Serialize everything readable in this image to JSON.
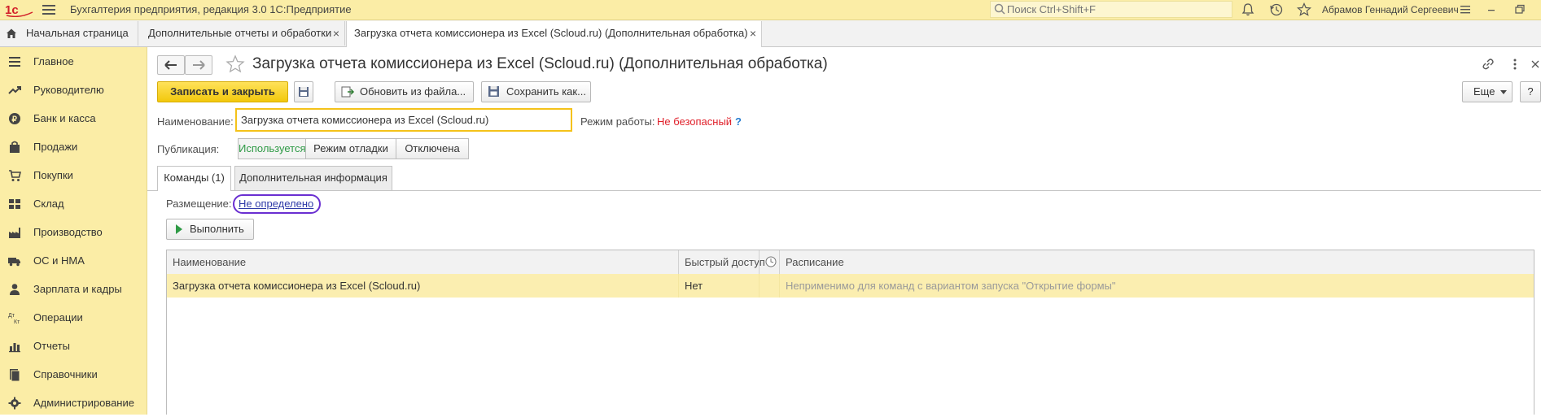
{
  "app": {
    "title": "Бухгалтерия предприятия, редакция 3.0 1С:Предприятие",
    "search_placeholder": "Поиск Ctrl+Shift+F",
    "user": "Абрамов Геннадий Сергеевич"
  },
  "tabs": {
    "home": "Начальная страница",
    "items": [
      {
        "label": "Дополнительные отчеты и обработки",
        "close": "×"
      },
      {
        "label": "Загрузка отчета комиссионера из Excel (Scloud.ru) (Дополнительная обработка)",
        "close": "×"
      }
    ]
  },
  "sidebar": {
    "items": [
      {
        "label": "Главное",
        "icon": "menu-lines-icon"
      },
      {
        "label": "Руководителю",
        "icon": "trend-icon"
      },
      {
        "label": "Банк и касса",
        "icon": "ruble-coin-icon"
      },
      {
        "label": "Продажи",
        "icon": "bag-icon"
      },
      {
        "label": "Покупки",
        "icon": "cart-icon"
      },
      {
        "label": "Склад",
        "icon": "boxes-icon"
      },
      {
        "label": "Производство",
        "icon": "factory-icon"
      },
      {
        "label": "ОС и НМА",
        "icon": "truck-icon"
      },
      {
        "label": "Зарплата и кадры",
        "icon": "person-icon"
      },
      {
        "label": "Операции",
        "icon": "dt-kt-icon"
      },
      {
        "label": "Отчеты",
        "icon": "bar-chart-icon"
      },
      {
        "label": "Справочники",
        "icon": "book-icon"
      },
      {
        "label": "Администрирование",
        "icon": "gear-icon"
      }
    ]
  },
  "form": {
    "title": "Загрузка отчета комиссионера из Excel (Scloud.ru) (Дополнительная обработка)",
    "toolbar": {
      "save_close": "Записать и закрыть",
      "update_from_file": "Обновить из файла...",
      "save_as": "Сохранить как...",
      "more": "Еще",
      "help": "?"
    },
    "name_label": "Наименование:",
    "name_value": "Загрузка отчета комиссионера из Excel (Scloud.ru)",
    "mode_label": "Режим работы:",
    "mode_value": "Не безопасный",
    "mode_help": "?",
    "publication_label": "Публикация:",
    "publication_options": [
      "Используется",
      "Режим отладки",
      "Отключена"
    ],
    "publication_selected": "Используется",
    "tabs": [
      "Команды (1)",
      "Дополнительная информация"
    ],
    "placement_label": "Размещение:",
    "placement_link": "Не определено",
    "run_button": "Выполнить",
    "grid": {
      "columns": [
        "Наименование",
        "Быстрый доступ",
        "",
        "Расписание"
      ],
      "rows": [
        [
          "Загрузка отчета комиссионера из Excel (Scloud.ru)",
          "Нет",
          "",
          "Неприменимо для команд с вариантом запуска \"Открытие формы\""
        ]
      ]
    }
  },
  "colors": {
    "accent_yellow": "#fbeda6",
    "primary_button": "#f2c80c",
    "danger_text": "#e0202a",
    "active_green": "#2e9a45",
    "link_oval": "#6a2fd1",
    "selected_row": "#fbeeb0"
  }
}
